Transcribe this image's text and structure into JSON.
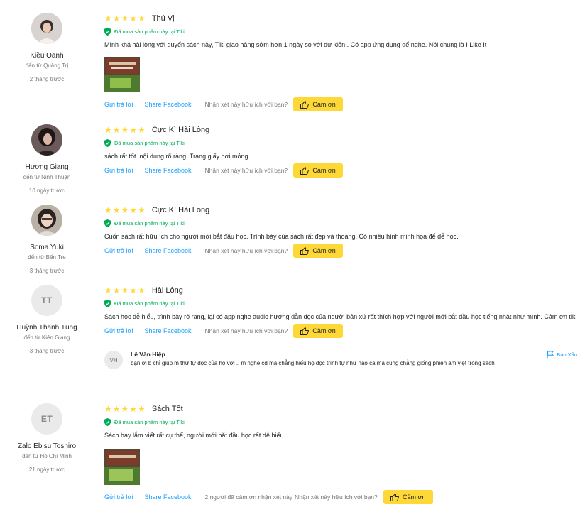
{
  "ui": {
    "reply_label": "Gửi trả lời",
    "share_label": "Share Facebook",
    "helpful_prompt": "Nhận xét này hữu ích với bạn?",
    "thanks_label": "Cảm ơn",
    "verified_label": "Đã mua sản phẩm này tại Tiki",
    "report_label": "Báo Xấu",
    "star_color": "#fdd836",
    "link_color": "#189eff",
    "verified_color": "#00ab56"
  },
  "reviews": [
    {
      "name": "Kiều Oanh",
      "from": "đến từ Quảng Trị",
      "time": "2 tháng trước",
      "avatar": "photo",
      "rating": 5,
      "title": "Thú Vị",
      "text": "Mình khá hài lòng với quyển sách này, Tiki giao hàng sớm hơn 1 ngày so với dự kiến.. Có app ứng dụng để nghe. Nói chung là I Like It",
      "has_image": true
    },
    {
      "name": "Hương Giang",
      "from": "đến từ Ninh Thuận",
      "time": "10 ngày trước",
      "avatar": "photo",
      "rating": 5,
      "title": "Cực Kì Hài Lòng",
      "text": "sách rất tốt. nội dung rõ ràng. Trang giấy hơi mỏng."
    },
    {
      "name": "Soma Yuki",
      "from": "đến từ Bến Tre",
      "time": "3 tháng trước",
      "avatar": "photo",
      "rating": 5,
      "title": "Cực Kì Hài Lòng",
      "text": "Cuốn sách rất hữu ích cho người mới bắt đầu học. Trình bày của sách rất đẹp và thoáng. Có nhiều hình minh họa để dễ học."
    },
    {
      "name": "Huỳnh Thanh Tùng",
      "from": "đến từ Kiên Giang",
      "time": "3 tháng trước",
      "avatar": "initials",
      "initials": "TT",
      "rating": 5,
      "title": "Hài Lòng",
      "text": "Sách học dễ hiểu, trình bày rõ ràng, lại có app nghe audio hướng dẫn đọc của người bản xứ rất thích hợp với người mới bắt đầu học tiếng nhật như mình. Cảm ơn tiki",
      "comment": {
        "initials": "VH",
        "name": "Lê Văn Hiệp",
        "text": "bạn ơi b chỉ giúp m thứ tự đọc của họ với .. m nghe cd mà chẳng hiểu họ đọc trình tự như nào cả mà cũng chẳng giống phiên âm việt trong sách"
      }
    },
    {
      "name": "Zalo Ebisu Toshiro",
      "from": "đến từ Hồ Chí Minh",
      "time": "21 ngày trước",
      "avatar": "initials",
      "initials": "ET",
      "rating": 5,
      "title": "Sách Tốt",
      "text": "Sách hay lắm viết rất cụ thể, người mới bắt đầu học rất dễ hiểu",
      "has_image": true,
      "thanks_count_text": "2 người đã cảm ơn nhận xét này"
    }
  ]
}
